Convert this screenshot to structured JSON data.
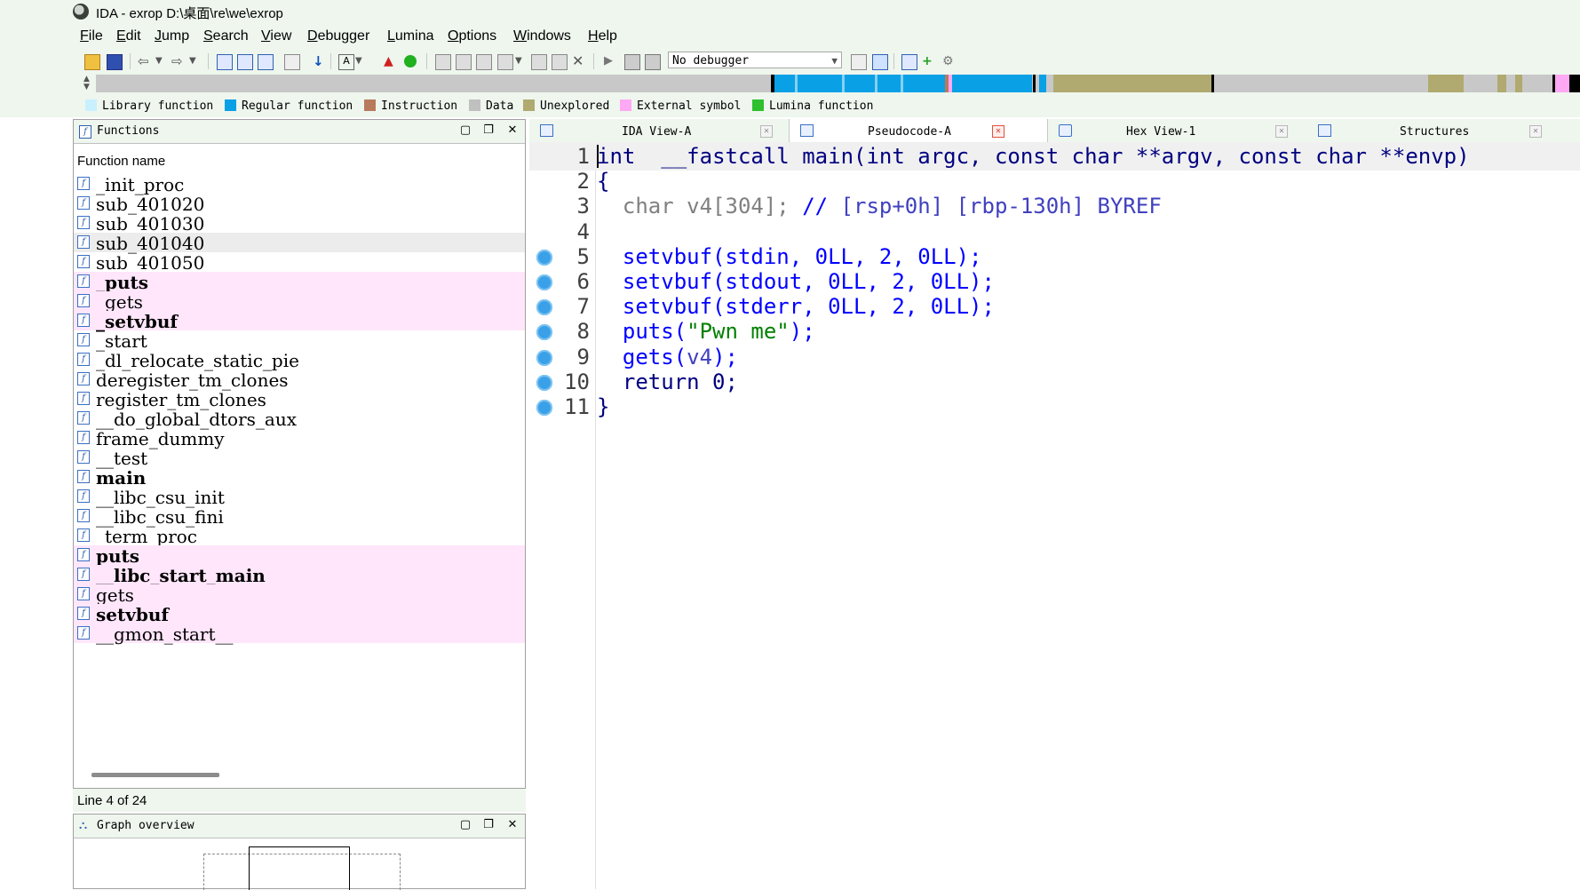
{
  "window": {
    "title": "IDA - exrop D:\\桌面\\re\\we\\exrop"
  },
  "menu": [
    "File",
    "Edit",
    "Jump",
    "Search",
    "View",
    "Debugger",
    "Lumina",
    "Options",
    "Windows",
    "Help"
  ],
  "toolbar": {
    "debugger_select": "No debugger"
  },
  "legend": [
    {
      "label": "Library function",
      "color": "#c8f0ff"
    },
    {
      "label": "Regular function",
      "color": "#0aa0e6"
    },
    {
      "label": "Instruction",
      "color": "#b97a5c"
    },
    {
      "label": "Data",
      "color": "#c0c0c0"
    },
    {
      "label": "Unexplored",
      "color": "#b0aa70"
    },
    {
      "label": "External symbol",
      "color": "#ffa8f4"
    },
    {
      "label": "Lumina function",
      "color": "#2ec02e"
    }
  ],
  "functions_pane": {
    "title": "Functions",
    "column_header": "Function name",
    "items": [
      {
        "name": "_init_proc",
        "pink": false,
        "bold": false
      },
      {
        "name": "sub_401020",
        "pink": false,
        "bold": false
      },
      {
        "name": "sub_401030",
        "pink": false,
        "bold": false
      },
      {
        "name": "sub_401040",
        "pink": false,
        "bold": false,
        "selected": true
      },
      {
        "name": "sub_401050",
        "pink": false,
        "bold": false
      },
      {
        "name": "_puts",
        "pink": true,
        "bold": true
      },
      {
        "name": "_gets",
        "pink": true,
        "bold": false
      },
      {
        "name": "_setvbuf",
        "pink": true,
        "bold": true
      },
      {
        "name": "_start",
        "pink": false,
        "bold": false
      },
      {
        "name": "_dl_relocate_static_pie",
        "pink": false,
        "bold": false
      },
      {
        "name": "deregister_tm_clones",
        "pink": false,
        "bold": false
      },
      {
        "name": "register_tm_clones",
        "pink": false,
        "bold": false
      },
      {
        "name": "__do_global_dtors_aux",
        "pink": false,
        "bold": false
      },
      {
        "name": "frame_dummy",
        "pink": false,
        "bold": false
      },
      {
        "name": "__test",
        "pink": false,
        "bold": false
      },
      {
        "name": "main",
        "pink": false,
        "bold": true
      },
      {
        "name": "__libc_csu_init",
        "pink": false,
        "bold": false
      },
      {
        "name": "__libc_csu_fini",
        "pink": false,
        "bold": false
      },
      {
        "name": "_term_proc",
        "pink": false,
        "bold": false
      },
      {
        "name": "puts",
        "pink": true,
        "bold": true
      },
      {
        "name": "__libc_start_main",
        "pink": true,
        "bold": true
      },
      {
        "name": "gets",
        "pink": true,
        "bold": false
      },
      {
        "name": "setvbuf",
        "pink": true,
        "bold": true
      },
      {
        "name": "__gmon_start__",
        "pink": true,
        "bold": false
      }
    ],
    "status": "Line 4 of 24"
  },
  "graph_overview": {
    "title": "Graph overview"
  },
  "tabs": [
    {
      "label": "IDA View-A",
      "active": false
    },
    {
      "label": "Pseudocode-A",
      "active": true
    },
    {
      "label": "Hex View-1",
      "active": false
    },
    {
      "label": "Structures",
      "active": false
    }
  ],
  "code": [
    {
      "n": "1",
      "bp": false,
      "parts": [
        [
          "kw-n",
          "int"
        ],
        [
          "",
          "  "
        ],
        [
          "kw-n",
          "__fastcall"
        ],
        [
          "",
          " "
        ],
        [
          "kw-n",
          "main"
        ],
        [
          "kw-n",
          "(int argc, const char **argv, const char **envp)"
        ]
      ]
    },
    {
      "n": "2",
      "bp": false,
      "parts": [
        [
          "kw-n",
          "{"
        ]
      ]
    },
    {
      "n": "3",
      "bp": false,
      "parts": [
        [
          "",
          "  "
        ],
        [
          "c-gray",
          "char v4[304];"
        ],
        [
          "kw-b",
          " // "
        ],
        [
          "c-var",
          "[rsp+0h] [rbp-130h] BYREF"
        ]
      ]
    },
    {
      "n": "4",
      "bp": false,
      "parts": [
        [
          "",
          ""
        ]
      ]
    },
    {
      "n": "5",
      "bp": true,
      "parts": [
        [
          "",
          "  "
        ],
        [
          "kw-b",
          "setvbuf(stdin, 0LL, 2, 0LL);"
        ]
      ]
    },
    {
      "n": "6",
      "bp": true,
      "parts": [
        [
          "",
          "  "
        ],
        [
          "kw-b",
          "setvbuf(stdout, 0LL, 2, 0LL);"
        ]
      ]
    },
    {
      "n": "7",
      "bp": true,
      "parts": [
        [
          "",
          "  "
        ],
        [
          "kw-b",
          "setvbuf(stderr, 0LL, 2, 0LL);"
        ]
      ]
    },
    {
      "n": "8",
      "bp": true,
      "parts": [
        [
          "",
          "  "
        ],
        [
          "kw-b",
          "puts("
        ],
        [
          "c-str",
          "\"Pwn me\""
        ],
        [
          "kw-b",
          ");"
        ]
      ]
    },
    {
      "n": "9",
      "bp": true,
      "parts": [
        [
          "",
          "  "
        ],
        [
          "kw-b",
          "gets("
        ],
        [
          "c-var",
          "v4"
        ],
        [
          "kw-b",
          ");"
        ]
      ]
    },
    {
      "n": "10",
      "bp": true,
      "parts": [
        [
          "",
          "  "
        ],
        [
          "kw-n",
          "return 0;"
        ]
      ]
    },
    {
      "n": "11",
      "bp": true,
      "parts": [
        [
          "kw-n",
          "}"
        ]
      ]
    }
  ]
}
